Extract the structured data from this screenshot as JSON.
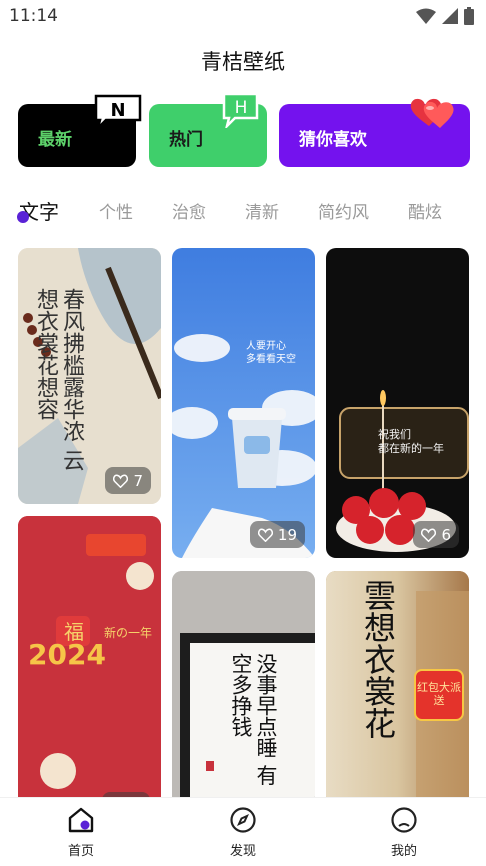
{
  "status": {
    "time": "11:14"
  },
  "app": {
    "title": "青桔壁纸"
  },
  "categories": [
    {
      "label": "最新",
      "badge": "N"
    },
    {
      "label": "热门",
      "badge": "H"
    },
    {
      "label": "猜你喜欢"
    }
  ],
  "tabs": [
    "文字",
    "个性",
    "治愈",
    "清新",
    "简约风",
    "酷炫"
  ],
  "active_tab": "文字",
  "cards": [
    {
      "likes": "7",
      "text_lines": [
        "春风拂槛露华浓",
        "云想衣裳花想容"
      ]
    },
    {
      "likes": "19",
      "text_lines": [
        "人要开心",
        "多看看天空"
      ]
    },
    {
      "likes": "6",
      "text_lines": [
        "祝我们",
        "都在新的一年"
      ]
    },
    {
      "text_lines": [
        "2024",
        "福",
        "新の一年"
      ]
    },
    {
      "text_lines": [
        "没事早点睡",
        "有空多挣钱"
      ]
    },
    {
      "text_lines": [
        "雲想衣裳花"
      ],
      "badge": "红包大派送"
    }
  ],
  "bottom_nav": [
    {
      "label": "首页"
    },
    {
      "label": "发现"
    },
    {
      "label": "我的"
    }
  ],
  "colors": {
    "accent": "#7412ee",
    "green": "#3fcf6b",
    "black": "#000000"
  }
}
